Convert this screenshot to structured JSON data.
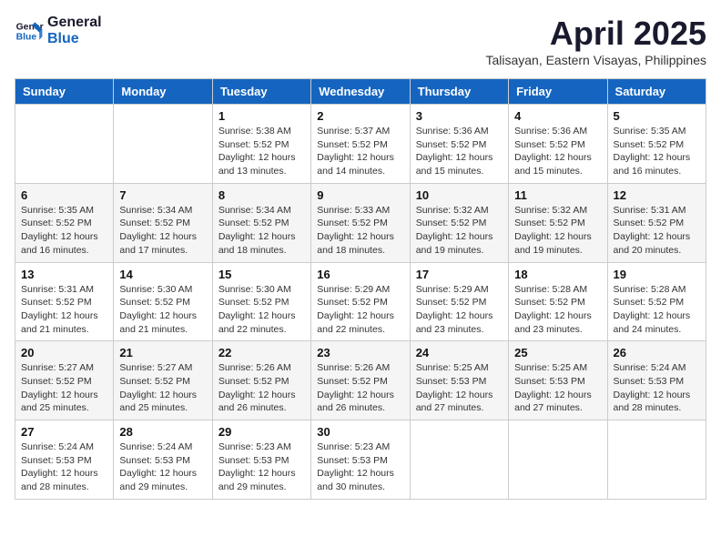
{
  "header": {
    "logo_line1": "General",
    "logo_line2": "Blue",
    "month_year": "April 2025",
    "location": "Talisayan, Eastern Visayas, Philippines"
  },
  "weekdays": [
    "Sunday",
    "Monday",
    "Tuesday",
    "Wednesday",
    "Thursday",
    "Friday",
    "Saturday"
  ],
  "weeks": [
    [
      {
        "day": "",
        "info": ""
      },
      {
        "day": "",
        "info": ""
      },
      {
        "day": "1",
        "info": "Sunrise: 5:38 AM\nSunset: 5:52 PM\nDaylight: 12 hours\nand 13 minutes."
      },
      {
        "day": "2",
        "info": "Sunrise: 5:37 AM\nSunset: 5:52 PM\nDaylight: 12 hours\nand 14 minutes."
      },
      {
        "day": "3",
        "info": "Sunrise: 5:36 AM\nSunset: 5:52 PM\nDaylight: 12 hours\nand 15 minutes."
      },
      {
        "day": "4",
        "info": "Sunrise: 5:36 AM\nSunset: 5:52 PM\nDaylight: 12 hours\nand 15 minutes."
      },
      {
        "day": "5",
        "info": "Sunrise: 5:35 AM\nSunset: 5:52 PM\nDaylight: 12 hours\nand 16 minutes."
      }
    ],
    [
      {
        "day": "6",
        "info": "Sunrise: 5:35 AM\nSunset: 5:52 PM\nDaylight: 12 hours\nand 16 minutes."
      },
      {
        "day": "7",
        "info": "Sunrise: 5:34 AM\nSunset: 5:52 PM\nDaylight: 12 hours\nand 17 minutes."
      },
      {
        "day": "8",
        "info": "Sunrise: 5:34 AM\nSunset: 5:52 PM\nDaylight: 12 hours\nand 18 minutes."
      },
      {
        "day": "9",
        "info": "Sunrise: 5:33 AM\nSunset: 5:52 PM\nDaylight: 12 hours\nand 18 minutes."
      },
      {
        "day": "10",
        "info": "Sunrise: 5:32 AM\nSunset: 5:52 PM\nDaylight: 12 hours\nand 19 minutes."
      },
      {
        "day": "11",
        "info": "Sunrise: 5:32 AM\nSunset: 5:52 PM\nDaylight: 12 hours\nand 19 minutes."
      },
      {
        "day": "12",
        "info": "Sunrise: 5:31 AM\nSunset: 5:52 PM\nDaylight: 12 hours\nand 20 minutes."
      }
    ],
    [
      {
        "day": "13",
        "info": "Sunrise: 5:31 AM\nSunset: 5:52 PM\nDaylight: 12 hours\nand 21 minutes."
      },
      {
        "day": "14",
        "info": "Sunrise: 5:30 AM\nSunset: 5:52 PM\nDaylight: 12 hours\nand 21 minutes."
      },
      {
        "day": "15",
        "info": "Sunrise: 5:30 AM\nSunset: 5:52 PM\nDaylight: 12 hours\nand 22 minutes."
      },
      {
        "day": "16",
        "info": "Sunrise: 5:29 AM\nSunset: 5:52 PM\nDaylight: 12 hours\nand 22 minutes."
      },
      {
        "day": "17",
        "info": "Sunrise: 5:29 AM\nSunset: 5:52 PM\nDaylight: 12 hours\nand 23 minutes."
      },
      {
        "day": "18",
        "info": "Sunrise: 5:28 AM\nSunset: 5:52 PM\nDaylight: 12 hours\nand 23 minutes."
      },
      {
        "day": "19",
        "info": "Sunrise: 5:28 AM\nSunset: 5:52 PM\nDaylight: 12 hours\nand 24 minutes."
      }
    ],
    [
      {
        "day": "20",
        "info": "Sunrise: 5:27 AM\nSunset: 5:52 PM\nDaylight: 12 hours\nand 25 minutes."
      },
      {
        "day": "21",
        "info": "Sunrise: 5:27 AM\nSunset: 5:52 PM\nDaylight: 12 hours\nand 25 minutes."
      },
      {
        "day": "22",
        "info": "Sunrise: 5:26 AM\nSunset: 5:52 PM\nDaylight: 12 hours\nand 26 minutes."
      },
      {
        "day": "23",
        "info": "Sunrise: 5:26 AM\nSunset: 5:52 PM\nDaylight: 12 hours\nand 26 minutes."
      },
      {
        "day": "24",
        "info": "Sunrise: 5:25 AM\nSunset: 5:53 PM\nDaylight: 12 hours\nand 27 minutes."
      },
      {
        "day": "25",
        "info": "Sunrise: 5:25 AM\nSunset: 5:53 PM\nDaylight: 12 hours\nand 27 minutes."
      },
      {
        "day": "26",
        "info": "Sunrise: 5:24 AM\nSunset: 5:53 PM\nDaylight: 12 hours\nand 28 minutes."
      }
    ],
    [
      {
        "day": "27",
        "info": "Sunrise: 5:24 AM\nSunset: 5:53 PM\nDaylight: 12 hours\nand 28 minutes."
      },
      {
        "day": "28",
        "info": "Sunrise: 5:24 AM\nSunset: 5:53 PM\nDaylight: 12 hours\nand 29 minutes."
      },
      {
        "day": "29",
        "info": "Sunrise: 5:23 AM\nSunset: 5:53 PM\nDaylight: 12 hours\nand 29 minutes."
      },
      {
        "day": "30",
        "info": "Sunrise: 5:23 AM\nSunset: 5:53 PM\nDaylight: 12 hours\nand 30 minutes."
      },
      {
        "day": "",
        "info": ""
      },
      {
        "day": "",
        "info": ""
      },
      {
        "day": "",
        "info": ""
      }
    ]
  ]
}
